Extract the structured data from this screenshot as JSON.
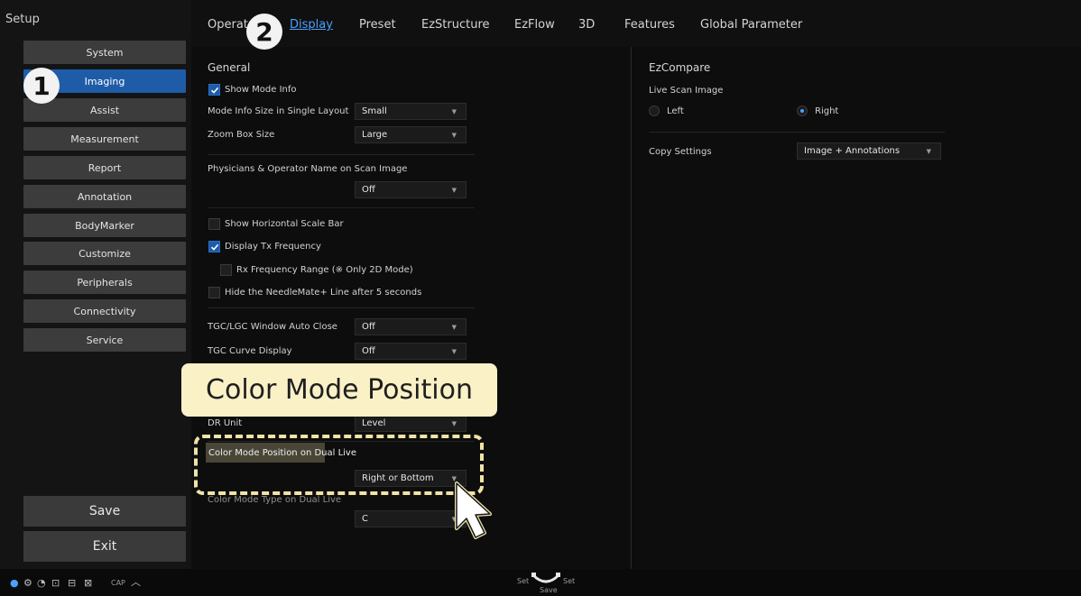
{
  "sidebar": {
    "title": "Setup",
    "items": [
      {
        "label": "System"
      },
      {
        "label": "Imaging"
      },
      {
        "label": "Assist"
      },
      {
        "label": "Measurement"
      },
      {
        "label": "Report"
      },
      {
        "label": "Annotation"
      },
      {
        "label": "BodyMarker"
      },
      {
        "label": "Customize"
      },
      {
        "label": "Peripherals"
      },
      {
        "label": "Connectivity"
      },
      {
        "label": "Service"
      }
    ],
    "active_index": 1,
    "save_label": "Save",
    "exit_label": "Exit"
  },
  "tabs": [
    {
      "label": "Operat"
    },
    {
      "label": "Display"
    },
    {
      "label": "Preset"
    },
    {
      "label": "EzStructure"
    },
    {
      "label": "EzFlow"
    },
    {
      "label": "3D"
    },
    {
      "label": "Features"
    },
    {
      "label": "Global Parameter"
    }
  ],
  "active_tab": "Display",
  "general": {
    "title": "General",
    "show_mode_info": {
      "label": "Show Mode Info",
      "checked": true
    },
    "mode_info_size": {
      "label": "Mode Info Size in Single Layout",
      "value": "Small"
    },
    "zoom_box_size": {
      "label": "Zoom Box Size",
      "value": "Large"
    },
    "physicians_name": {
      "label": "Physicians & Operator Name on Scan Image",
      "value": "Off"
    },
    "show_horizontal_scale_bar": {
      "label": "Show Horizontal Scale Bar",
      "checked": false
    },
    "display_tx_frequency": {
      "label": "Display Tx Frequency",
      "checked": true
    },
    "rx_frequency_range": {
      "label": "Rx Frequency Range (※ Only 2D Mode)",
      "checked": false
    },
    "hide_needlemate_line": {
      "label": "Hide the NeedleMate+ Line after 5 seconds",
      "checked": false
    },
    "tgc_lgc_window_auto_close": {
      "label": "TGC/LGC Window Auto Close",
      "value": "Off"
    },
    "tgc_curve_display": {
      "label": "TGC Curve Display",
      "value": "Off"
    },
    "dr_unit": {
      "label": "DR Unit",
      "value": "Level"
    },
    "color_mode_position": {
      "label": "Color Mode Position on Dual Live",
      "value": "Right or Bottom"
    },
    "color_mode_type": {
      "label": "Color Mode Type on Dual Live",
      "value": "C"
    }
  },
  "ezcompare": {
    "title": "EzCompare",
    "live_scan_label": "Live Scan Image",
    "left_label": "Left",
    "right_label": "Right",
    "selected": "Right",
    "copy_settings_label": "Copy Settings",
    "copy_settings_value": "Image + Annotations"
  },
  "statusbar": {
    "cap_label": "CAP",
    "set_left": "Set",
    "set_right": "Set",
    "save_label": "Save"
  },
  "overlay": {
    "callout_text": "Color Mode Position",
    "badge_1": "1",
    "badge_2": "2"
  },
  "colors": {
    "accent_blue": "#1e5ca8",
    "link_blue": "#4aa0ff",
    "callout_bg": "#fbf1c7",
    "dash_color": "#f0e3a6"
  }
}
